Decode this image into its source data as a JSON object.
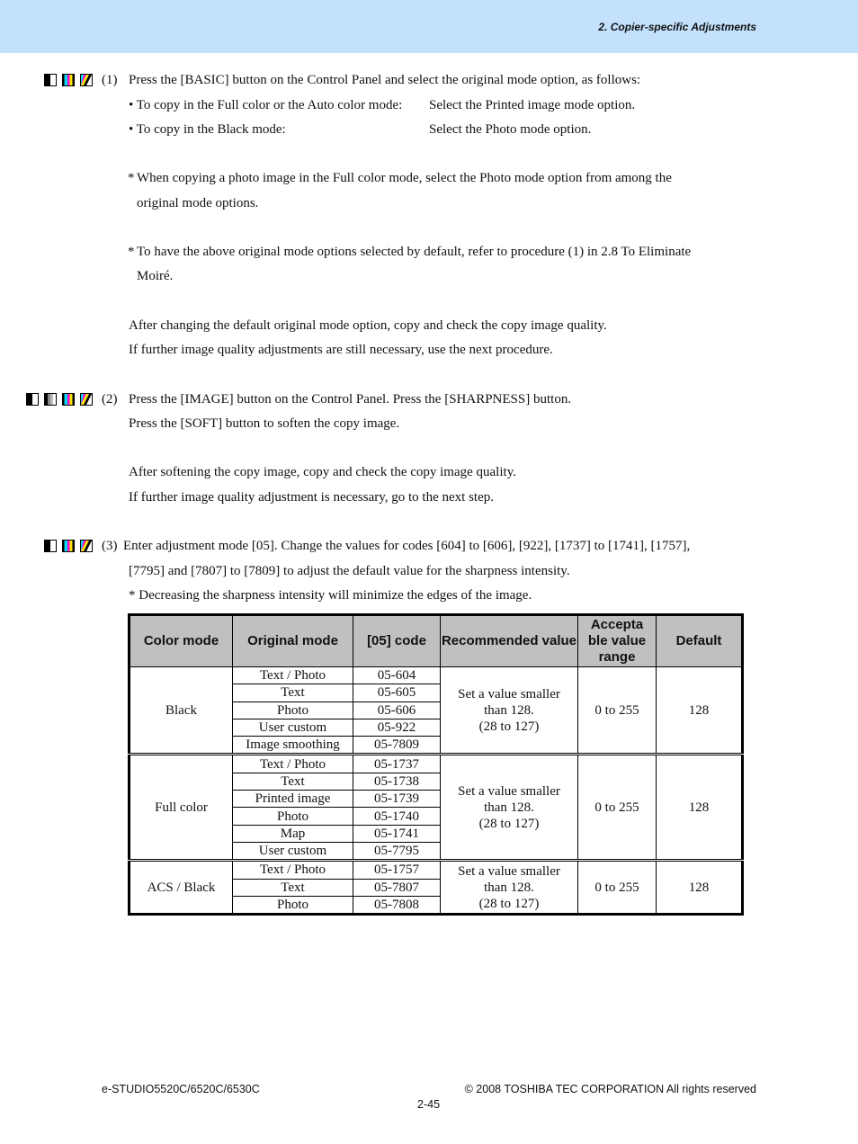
{
  "header": {
    "section_title": "2. Copier-specific Adjustments"
  },
  "icons": {
    "black": "black-mode-icon",
    "twin": "twin-color-mode-icon",
    "full_color": "full-color-mode-icon",
    "acs": "auto-color-mode-icon"
  },
  "steps": [
    {
      "number": "(1)",
      "lines": [
        "Press the [BASIC] button on the Control Panel and select the original mode option, as follows:"
      ],
      "bullets": [
        {
          "label": "• To copy in the Full color or the Auto color mode:",
          "value": "Select the Printed image mode option."
        },
        {
          "label": "• To copy in the Black mode:",
          "value": "Select the Photo mode option."
        }
      ],
      "notes": [
        {
          "mark": "*",
          "line1": "When copying a photo image in the Full color mode, select the Photo mode option from among the",
          "line2": "original mode options."
        },
        {
          "mark": "*",
          "line1": "To have the above original mode options selected by default, refer to procedure (1) in 2.8 To Eliminate",
          "line2": "Moiré."
        }
      ],
      "after": [
        "After changing the default original mode option, copy and check the copy image quality.",
        "If further image quality adjustments are still necessary, use the next procedure."
      ]
    },
    {
      "number": "(2)",
      "lines": [
        "Press the [IMAGE] button on the Control Panel.  Press the [SHARPNESS] button.",
        "Press the [SOFT] button to soften the copy image."
      ],
      "after": [
        "After softening the copy image, copy and check the copy image quality.",
        "If further image quality adjustment is necessary, go to the next step."
      ]
    },
    {
      "number": "(3)",
      "lines": [
        "Enter adjustment mode [05]. Change the values for codes [604] to [606], [922], [1737] to [1741], [1757],",
        "[7795] and [7807] to [7809] to adjust the default value for the sharpness intensity.",
        "* Decreasing the sharpness intensity will minimize the edges of the image."
      ]
    }
  ],
  "table": {
    "headers": [
      "Color mode",
      "Original mode",
      "[05] code",
      "Recommended value",
      "Accepta ble value range",
      "Default"
    ],
    "groups": [
      {
        "color_mode": "Black",
        "rows": [
          {
            "original_mode": "Text / Photo",
            "code": "05-604"
          },
          {
            "original_mode": "Text",
            "code": "05-605"
          },
          {
            "original_mode": "Photo",
            "code": "05-606"
          },
          {
            "original_mode": "User custom",
            "code": "05-922"
          },
          {
            "original_mode": "Image smoothing",
            "code": "05-7809"
          }
        ],
        "recommended": [
          "Set a value smaller",
          "than 128.",
          "(28 to 127)"
        ],
        "range": "0 to 255",
        "default": "128"
      },
      {
        "color_mode": "Full color",
        "rows": [
          {
            "original_mode": "Text / Photo",
            "code": "05-1737"
          },
          {
            "original_mode": "Text",
            "code": "05-1738"
          },
          {
            "original_mode": "Printed image",
            "code": "05-1739"
          },
          {
            "original_mode": "Photo",
            "code": "05-1740"
          },
          {
            "original_mode": "Map",
            "code": "05-1741"
          },
          {
            "original_mode": "User custom",
            "code": "05-7795"
          }
        ],
        "recommended": [
          "Set a value smaller",
          "than 128.",
          "(28 to 127)"
        ],
        "range": "0 to 255",
        "default": "128"
      },
      {
        "color_mode": "ACS / Black",
        "rows": [
          {
            "original_mode": "Text / Photo",
            "code": "05-1757"
          },
          {
            "original_mode": "Text",
            "code": "05-7807"
          },
          {
            "original_mode": "Photo",
            "code": "05-7808"
          }
        ],
        "recommended": [
          "Set a value smaller",
          "than 128.",
          "(28 to 127)"
        ],
        "range": "0 to 255",
        "default": "128"
      }
    ]
  },
  "footer": {
    "model": "e-STUDIO5520C/6520C/6530C",
    "copyright": "© 2008 TOSHIBA TEC CORPORATION All rights reserved",
    "page": "2-45"
  }
}
